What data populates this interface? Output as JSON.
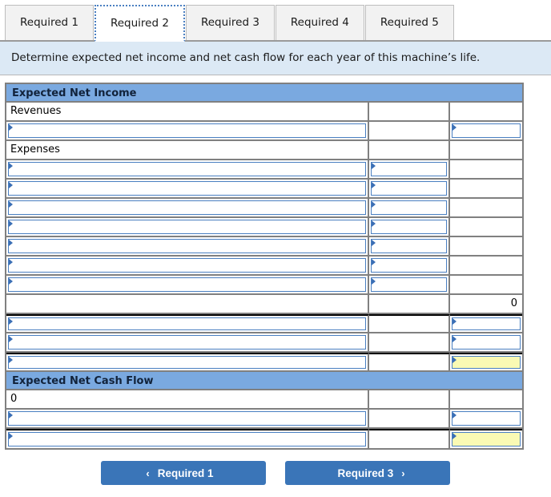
{
  "tabs": [
    {
      "label": "Required 1",
      "active": false
    },
    {
      "label": "Required 2",
      "active": true
    },
    {
      "label": "Required 3",
      "active": false
    },
    {
      "label": "Required 4",
      "active": false
    },
    {
      "label": "Required 5",
      "active": false
    }
  ],
  "instruction": {
    "text": "Determine expected net income and net cash flow for each year of this machine’s life."
  },
  "sheet": {
    "sections": [
      {
        "title": "Expected Net Income",
        "rows": [
          {
            "kind": "label",
            "c1": "Revenues",
            "c2": "",
            "c3": ""
          },
          {
            "kind": "input",
            "c1": "",
            "c2": "",
            "c3": "",
            "editable": [
              true,
              false,
              true
            ]
          },
          {
            "kind": "label",
            "c1": "Expenses",
            "c2": "",
            "c3": ""
          },
          {
            "kind": "input",
            "c1": "",
            "c2": "",
            "c3": "",
            "editable": [
              true,
              true,
              false
            ]
          },
          {
            "kind": "input",
            "c1": "",
            "c2": "",
            "c3": "",
            "editable": [
              true,
              true,
              false
            ]
          },
          {
            "kind": "input",
            "c1": "",
            "c2": "",
            "c3": "",
            "editable": [
              true,
              true,
              false
            ]
          },
          {
            "kind": "input",
            "c1": "",
            "c2": "",
            "c3": "",
            "editable": [
              true,
              true,
              false
            ]
          },
          {
            "kind": "input",
            "c1": "",
            "c2": "",
            "c3": "",
            "editable": [
              true,
              true,
              false
            ]
          },
          {
            "kind": "input",
            "c1": "",
            "c2": "",
            "c3": "",
            "editable": [
              true,
              true,
              false
            ]
          },
          {
            "kind": "input",
            "c1": "",
            "c2": "",
            "c3": "",
            "editable": [
              true,
              true,
              false
            ]
          },
          {
            "kind": "value",
            "c1": "",
            "c2": "",
            "c3": "0"
          },
          {
            "kind": "input",
            "c1": "",
            "c2": "",
            "c3": "",
            "editable": [
              true,
              false,
              true
            ],
            "topline": true
          },
          {
            "kind": "input",
            "c1": "",
            "c2": "",
            "c3": "",
            "editable": [
              true,
              false,
              true
            ]
          },
          {
            "kind": "input",
            "c1": "",
            "c2": "",
            "c3": "",
            "editable": [
              true,
              false,
              true
            ],
            "topline": true,
            "highlight": true
          }
        ]
      },
      {
        "title": "Expected Net Cash Flow",
        "rows": [
          {
            "kind": "value",
            "c1": "0",
            "c2": "",
            "c3": ""
          },
          {
            "kind": "input",
            "c1": "",
            "c2": "",
            "c3": "",
            "editable": [
              true,
              false,
              true
            ]
          },
          {
            "kind": "input",
            "c1": "",
            "c2": "",
            "c3": "",
            "editable": [
              true,
              false,
              true
            ],
            "topline": true,
            "highlight": true
          }
        ]
      }
    ]
  },
  "footer": {
    "prev": {
      "label": "Required 1",
      "chevron": "‹"
    },
    "next": {
      "label": "Required 3",
      "chevron": "›"
    }
  }
}
